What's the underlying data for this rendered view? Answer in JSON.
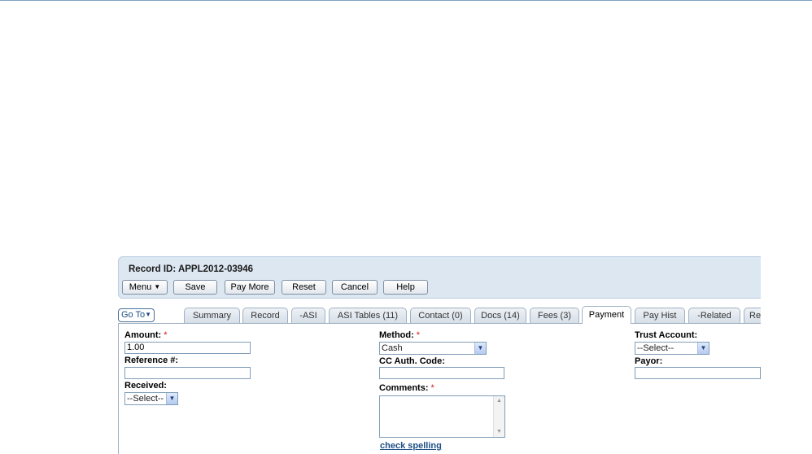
{
  "header": {
    "record_label": "Record ID:",
    "record_id": "APPL2012-03946"
  },
  "toolbar": {
    "menu_label": "Menu",
    "save_label": "Save",
    "pay_more_label": "Pay More",
    "reset_label": "Reset",
    "cancel_label": "Cancel",
    "help_label": "Help"
  },
  "nav": {
    "goto_label": "Go To",
    "tabs": [
      {
        "label": "Summary"
      },
      {
        "label": "Record"
      },
      {
        "label": "-ASI"
      },
      {
        "label": "ASI Tables (11)"
      },
      {
        "label": "Contact (0)"
      },
      {
        "label": "Docs (14)"
      },
      {
        "label": "Fees (3)"
      },
      {
        "label": "Payment",
        "active": true
      },
      {
        "label": "Pay Hist"
      },
      {
        "label": "-Related"
      },
      {
        "label": "Re"
      }
    ]
  },
  "form": {
    "amount": {
      "label": "Amount:",
      "required": "*",
      "value": "1.00"
    },
    "reference": {
      "label": "Reference #:",
      "value": ""
    },
    "received": {
      "label": "Received:",
      "selected": "--Select--"
    },
    "method": {
      "label": "Method:",
      "required": "*",
      "selected": "Cash"
    },
    "cc_auth": {
      "label": "CC Auth. Code:",
      "value": ""
    },
    "comments": {
      "label": "Comments:",
      "required": "*",
      "value": ""
    },
    "check_spelling": "check spelling",
    "trust_account": {
      "label": "Trust Account:",
      "selected": "--Select--"
    },
    "payor": {
      "label": "Payor:",
      "value": ""
    }
  },
  "icons": {
    "dropdown_arrow": "chevron-down-icon",
    "menu_caret": "triangle-down-icon"
  },
  "colors": {
    "panel_bg": "#dde7f2",
    "link": "#1d4f86",
    "required": "#d11"
  }
}
